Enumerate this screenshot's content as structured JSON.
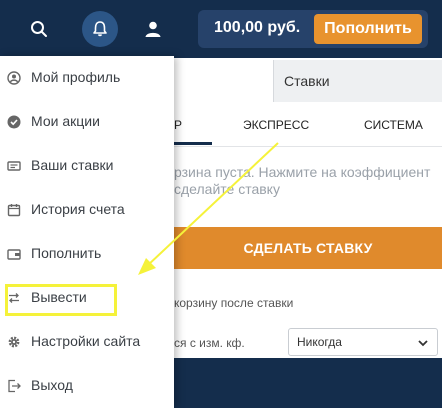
{
  "colors": {
    "topbar": "#142d4c",
    "accent": "#e8932e",
    "annotation": "#f5f23a"
  },
  "topbar": {
    "balance": "100,00 руб.",
    "topup_label": "Пополнить",
    "icons": [
      "search-icon",
      "bell-icon",
      "user-icon"
    ]
  },
  "menu": {
    "items": [
      {
        "label": "Мой профиль",
        "icon": "user-circle-icon"
      },
      {
        "label": "Мои акции",
        "icon": "check-circle-icon"
      },
      {
        "label": "Ваши ставки",
        "icon": "ticket-icon"
      },
      {
        "label": "История счета",
        "icon": "calendar-icon"
      },
      {
        "label": "Пополнить",
        "icon": "wallet-icon"
      },
      {
        "label": "Вывести",
        "icon": "transfer-icon"
      },
      {
        "label": "Настройки сайта",
        "icon": "gear-icon"
      },
      {
        "label": "Выход",
        "icon": "logout-icon"
      }
    ]
  },
  "betslip": {
    "header": "Ставки",
    "tabs": [
      "Р",
      "ЭКСПРЕСС",
      "СИСТЕМА"
    ],
    "empty_line1": "рзина пуста. Нажмите на коэффициент",
    "empty_line2": "сделайте ставку",
    "place_bet": "СДЕЛАТЬ СТАВКУ",
    "clear_after": "корзину после ставки",
    "odds_change": "ся с изм. кф.",
    "odds_select": "Никогда"
  }
}
